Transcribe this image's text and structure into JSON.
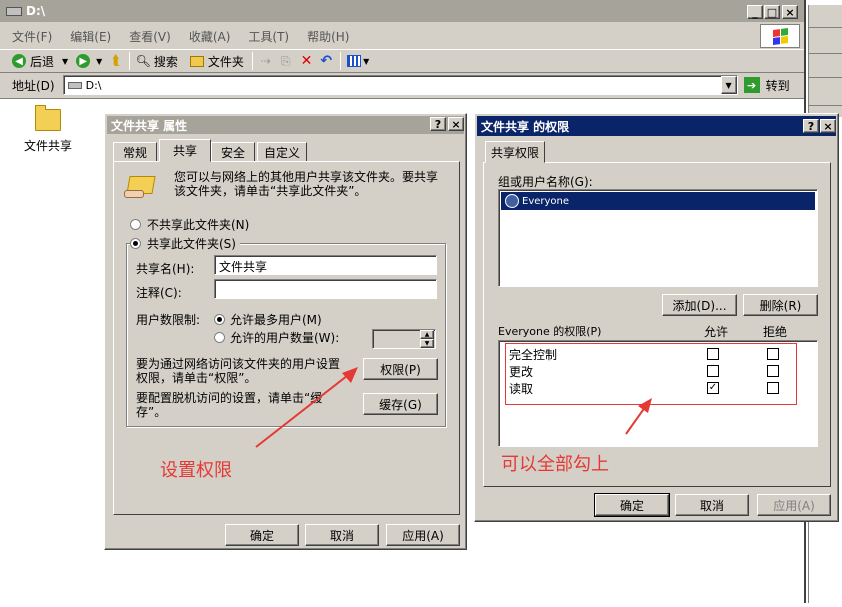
{
  "explorer": {
    "title": "D:\\",
    "menu": [
      "文件(F)",
      "编辑(E)",
      "查看(V)",
      "收藏(A)",
      "工具(T)",
      "帮助(H)"
    ],
    "toolbar": {
      "back": "后退",
      "search": "搜索",
      "folders": "文件夹"
    },
    "address_label": "地址(D)",
    "address_value": "D:\\",
    "go_label": "转到",
    "folder_icon_label": "文件共享"
  },
  "props": {
    "title": "文件共享 属性",
    "tabs": [
      "常规",
      "共享",
      "安全",
      "自定义"
    ],
    "info": "您可以与网络上的其他用户共享该文件夹。要共享该文件夹，请单击“共享此文件夹”。",
    "radio_noshare": "不共享此文件夹(N)",
    "radio_share": "共享此文件夹(S)",
    "share_name_label": "共享名(H):",
    "share_name_value": "文件共享",
    "comment_label": "注释(C):",
    "comment_value": "",
    "user_limit_label": "用户数限制:",
    "max_users": "允许最多用户(M)",
    "allow_users": "允许的用户数量(W):",
    "perm_text": "要为通过网络访问该文件夹的用户设置权限，请单击“权限”。",
    "perm_button": "权限(P)",
    "cache_text": "要配置脱机访问的设置，请单击“缓存”。",
    "cache_button": "缓存(G)",
    "ok": "确定",
    "cancel": "取消",
    "apply": "应用(A)"
  },
  "perm": {
    "title": "文件共享 的权限",
    "tab": "共享权限",
    "group_label": "组或用户名称(G):",
    "users": [
      "Everyone"
    ],
    "add_button": "添加(D)...",
    "remove_button": "删除(R)",
    "perm_for": "Everyone 的权限(P)",
    "col_allow": "允许",
    "col_deny": "拒绝",
    "rows": [
      {
        "name": "完全控制",
        "allow": false,
        "deny": false
      },
      {
        "name": "更改",
        "allow": false,
        "deny": false
      },
      {
        "name": "读取",
        "allow": true,
        "deny": false
      }
    ],
    "ok": "确定",
    "cancel": "取消",
    "apply": "应用(A)"
  },
  "annotations": {
    "set_permission": "设置权限",
    "check_all": "可以全部勾上",
    "color": "#e53935"
  }
}
